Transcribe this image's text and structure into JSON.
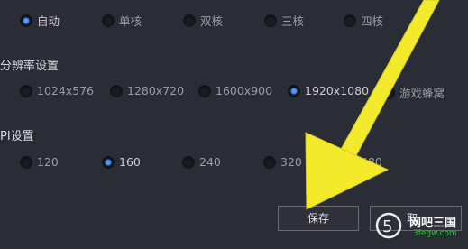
{
  "cpu": {
    "options": [
      {
        "label": "自动",
        "checked": true
      },
      {
        "label": "单核",
        "checked": false
      },
      {
        "label": "双核",
        "checked": false
      },
      {
        "label": "三核",
        "checked": false
      },
      {
        "label": "四核",
        "checked": false
      }
    ]
  },
  "resolution": {
    "title": "分辨率设置",
    "options": [
      {
        "label": "1024x576",
        "checked": false
      },
      {
        "label": "1280x720",
        "checked": false
      },
      {
        "label": "1600x900",
        "checked": false
      },
      {
        "label": "1920x1080",
        "checked": true
      },
      {
        "label": "游戏蜂窝",
        "checked": false
      }
    ]
  },
  "dpi": {
    "title": "PI设置",
    "options": [
      {
        "label": "120",
        "checked": false
      },
      {
        "label": "160",
        "checked": true
      },
      {
        "label": "240",
        "checked": false
      },
      {
        "label": "320",
        "checked": false
      },
      {
        "label": "480",
        "checked": false
      }
    ]
  },
  "footer": {
    "save_label": "保存",
    "second_label": "取"
  },
  "watermark": {
    "text": "网吧三国",
    "url": "3fegw.com"
  },
  "colors": {
    "background": "#2b2d36",
    "selected": "#3c82ee",
    "arrow": "#f2ea2a"
  },
  "icons": {
    "arrow": "arrow-annotation-icon",
    "watermark_logo": "watermark-logo-icon"
  }
}
